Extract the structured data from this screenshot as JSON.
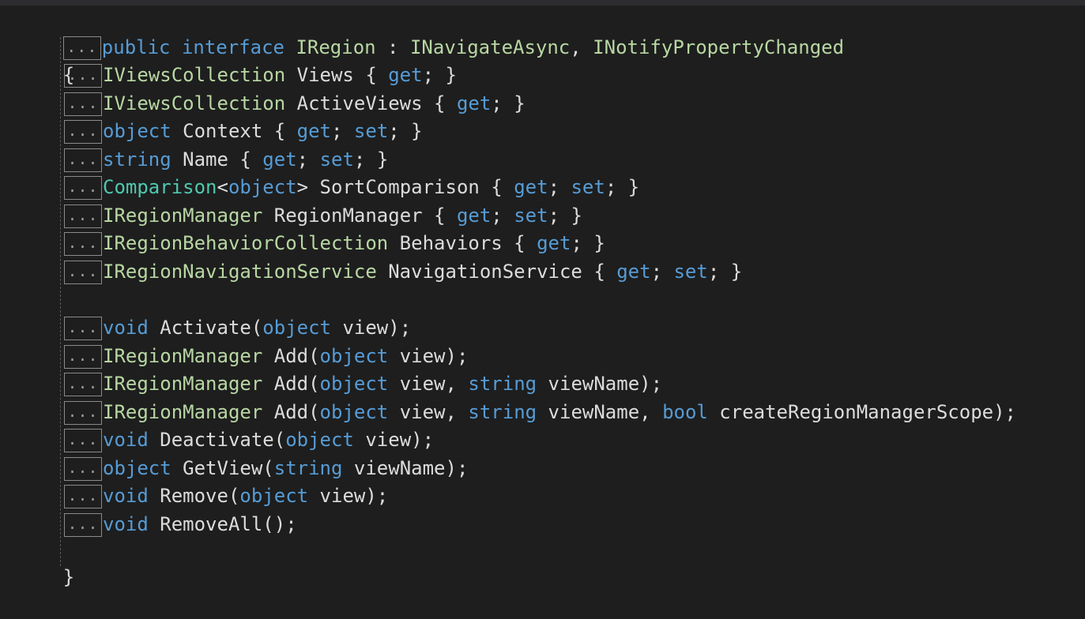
{
  "fold_marker": "...",
  "header": {
    "public_kw": "public",
    "interface_kw": "interface",
    "name": "IRegion",
    "colon": " : ",
    "base1": "INavigateAsync",
    "comma": ", ",
    "base2": "INotifyPropertyChanged"
  },
  "open_brace": "{",
  "close_brace": "}",
  "properties": [
    [
      {
        "t": "IViewsCollection",
        "c": "ty"
      },
      {
        "t": " Views { ",
        "c": "pl"
      },
      {
        "t": "get",
        "c": "kw"
      },
      {
        "t": "; }",
        "c": "pl"
      }
    ],
    [
      {
        "t": "IViewsCollection",
        "c": "ty"
      },
      {
        "t": " ActiveViews { ",
        "c": "pl"
      },
      {
        "t": "get",
        "c": "kw"
      },
      {
        "t": "; }",
        "c": "pl"
      }
    ],
    [
      {
        "t": "object",
        "c": "kw"
      },
      {
        "t": " Context { ",
        "c": "pl"
      },
      {
        "t": "get",
        "c": "kw"
      },
      {
        "t": "; ",
        "c": "pl"
      },
      {
        "t": "set",
        "c": "kw"
      },
      {
        "t": "; }",
        "c": "pl"
      }
    ],
    [
      {
        "t": "string",
        "c": "kw"
      },
      {
        "t": " Name { ",
        "c": "pl"
      },
      {
        "t": "get",
        "c": "kw"
      },
      {
        "t": "; ",
        "c": "pl"
      },
      {
        "t": "set",
        "c": "kw"
      },
      {
        "t": "; }",
        "c": "pl"
      }
    ],
    [
      {
        "t": "Comparison",
        "c": "cls"
      },
      {
        "t": "<",
        "c": "pl"
      },
      {
        "t": "object",
        "c": "kw"
      },
      {
        "t": "> SortComparison { ",
        "c": "pl"
      },
      {
        "t": "get",
        "c": "kw"
      },
      {
        "t": "; ",
        "c": "pl"
      },
      {
        "t": "set",
        "c": "kw"
      },
      {
        "t": "; }",
        "c": "pl"
      }
    ],
    [
      {
        "t": "IRegionManager",
        "c": "ty"
      },
      {
        "t": " RegionManager { ",
        "c": "pl"
      },
      {
        "t": "get",
        "c": "kw"
      },
      {
        "t": "; ",
        "c": "pl"
      },
      {
        "t": "set",
        "c": "kw"
      },
      {
        "t": "; }",
        "c": "pl"
      }
    ],
    [
      {
        "t": "IRegionBehaviorCollection",
        "c": "ty"
      },
      {
        "t": " Behaviors { ",
        "c": "pl"
      },
      {
        "t": "get",
        "c": "kw"
      },
      {
        "t": "; }",
        "c": "pl"
      }
    ],
    [
      {
        "t": "IRegionNavigationService",
        "c": "ty"
      },
      {
        "t": " NavigationService { ",
        "c": "pl"
      },
      {
        "t": "get",
        "c": "kw"
      },
      {
        "t": "; ",
        "c": "pl"
      },
      {
        "t": "set",
        "c": "kw"
      },
      {
        "t": "; }",
        "c": "pl"
      }
    ]
  ],
  "methods": [
    [
      {
        "t": "void",
        "c": "kw"
      },
      {
        "t": " Activate(",
        "c": "pl"
      },
      {
        "t": "object",
        "c": "kw"
      },
      {
        "t": " view);",
        "c": "pl"
      }
    ],
    [
      {
        "t": "IRegionManager",
        "c": "ty"
      },
      {
        "t": " Add(",
        "c": "pl"
      },
      {
        "t": "object",
        "c": "kw"
      },
      {
        "t": " view);",
        "c": "pl"
      }
    ],
    [
      {
        "t": "IRegionManager",
        "c": "ty"
      },
      {
        "t": " Add(",
        "c": "pl"
      },
      {
        "t": "object",
        "c": "kw"
      },
      {
        "t": " view, ",
        "c": "pl"
      },
      {
        "t": "string",
        "c": "kw"
      },
      {
        "t": " viewName);",
        "c": "pl"
      }
    ],
    [
      {
        "t": "IRegionManager",
        "c": "ty"
      },
      {
        "t": " Add(",
        "c": "pl"
      },
      {
        "t": "object",
        "c": "kw"
      },
      {
        "t": " view, ",
        "c": "pl"
      },
      {
        "t": "string",
        "c": "kw"
      },
      {
        "t": " viewName, ",
        "c": "pl"
      },
      {
        "t": "bool",
        "c": "kw"
      },
      {
        "t": " createRegionManagerScope);",
        "c": "pl"
      }
    ],
    [
      {
        "t": "void",
        "c": "kw"
      },
      {
        "t": " Deactivate(",
        "c": "pl"
      },
      {
        "t": "object",
        "c": "kw"
      },
      {
        "t": " view);",
        "c": "pl"
      }
    ],
    [
      {
        "t": "object",
        "c": "kw"
      },
      {
        "t": " GetView(",
        "c": "pl"
      },
      {
        "t": "string",
        "c": "kw"
      },
      {
        "t": " viewName);",
        "c": "pl"
      }
    ],
    [
      {
        "t": "void",
        "c": "kw"
      },
      {
        "t": " Remove(",
        "c": "pl"
      },
      {
        "t": "object",
        "c": "kw"
      },
      {
        "t": " view);",
        "c": "pl"
      }
    ],
    [
      {
        "t": "void",
        "c": "kw"
      },
      {
        "t": " RemoveAll();",
        "c": "pl"
      }
    ]
  ]
}
